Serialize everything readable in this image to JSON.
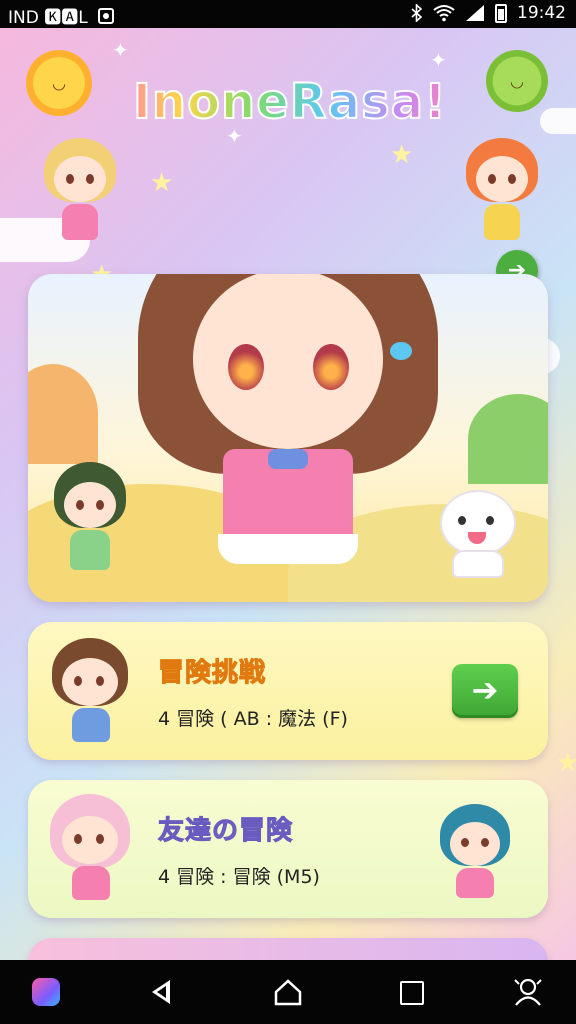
{
  "status_bar": {
    "left_text": "IND 🅺🅰L",
    "time": "19:42"
  },
  "app": {
    "title": "InoneRasa!",
    "hero": {
      "main_character": "chibi-girl-brown-hair",
      "companion": "white-cat-mascot"
    },
    "cards": [
      {
        "title": "冒険挑戦",
        "subtitle": "4 冒険 ( AB : 魔法 (F)",
        "button": "➔"
      },
      {
        "title": "友達の冒険",
        "subtitle": "4 冒険 : 冒険 (M5)"
      }
    ]
  },
  "nav_bar": {
    "back": "back",
    "home": "home",
    "recents": "recents",
    "assistant": "assistant"
  },
  "colors": {
    "accent_green": "#4cae3f",
    "card_yellow": "#fbf19f",
    "card_green": "#ecf8c3"
  }
}
